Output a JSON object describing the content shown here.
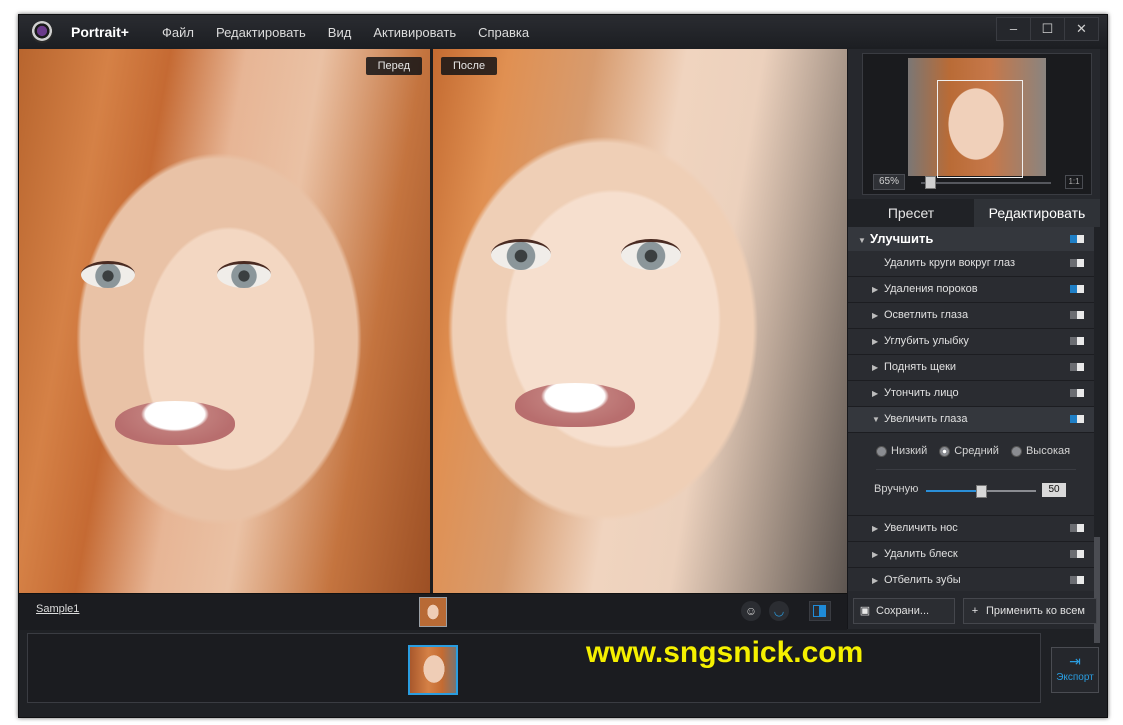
{
  "app": {
    "name": "Portrait+",
    "menu": [
      "Файл",
      "Редактировать",
      "Вид",
      "Активировать",
      "Справка"
    ],
    "window_buttons": [
      "–",
      "☐",
      "✕"
    ]
  },
  "viewer": {
    "before_label": "Перед",
    "after_label": "После",
    "sample_name": "Sample1"
  },
  "navigator": {
    "zoom": "65%",
    "fit_label": "1:1",
    "zoom_slider_fraction": 0.05
  },
  "panel": {
    "tabs": [
      "Пресет",
      "Редактировать"
    ],
    "active_tab": "Редактировать",
    "section_title": "Улучшить",
    "section_on": true,
    "items": [
      {
        "label": "Удалить круги вокруг глаз",
        "expandable": false,
        "on": false
      },
      {
        "label": "Удаления пороков",
        "expandable": true,
        "on": true
      },
      {
        "label": "Осветлить глаза",
        "expandable": true,
        "on": false
      },
      {
        "label": "Углубить улыбку",
        "expandable": true,
        "on": false
      },
      {
        "label": "Поднять щеки",
        "expandable": true,
        "on": false
      },
      {
        "label": "Утончить лицо",
        "expandable": true,
        "on": false
      },
      {
        "label": "Увеличить глаза",
        "expandable": true,
        "on": true,
        "open": true
      }
    ],
    "expanded": {
      "levels": [
        "Низкий",
        "Средний",
        "Высокая"
      ],
      "selected_level": "Средний",
      "manual_label": "Вручную",
      "manual_value": "50",
      "manual_fraction": 0.5
    },
    "items_after": [
      {
        "label": "Увеличить нос",
        "on": false
      },
      {
        "label": "Удалить блеск",
        "on": false
      },
      {
        "label": "Отбелить зубы",
        "on": false
      }
    ],
    "save_label": "Сохрани...",
    "apply_all_label": "Применить ко всем"
  },
  "bottom": {
    "watermark": "www.sngsnick.com",
    "export_label": "Экспорт"
  },
  "colors": {
    "accent": "#1f8bd8",
    "watermark": "#f5f000"
  }
}
